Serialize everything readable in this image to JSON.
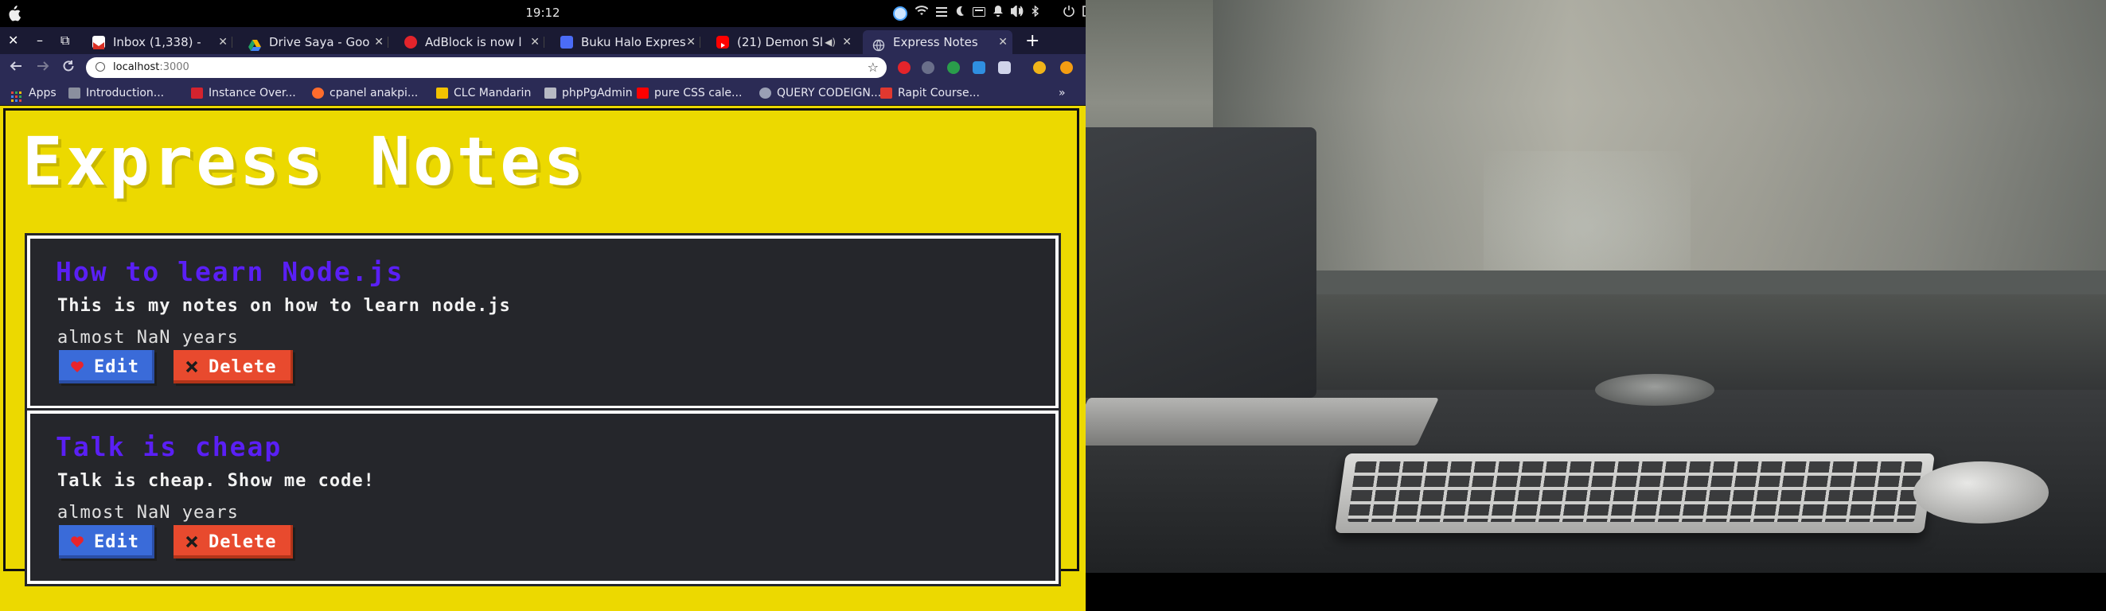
{
  "system_bar": {
    "clock": "19:12"
  },
  "browser": {
    "window_controls": [
      "✕",
      "–",
      "⧉"
    ],
    "tabs": [
      {
        "title": "Inbox (1,338) -",
        "favicon_color": "#d93025",
        "icon": "gmail-icon"
      },
      {
        "title": "Drive Saya - Goo",
        "favicon_color": "#1fa463",
        "icon": "drive-icon"
      },
      {
        "title": "AdBlock is now l",
        "favicon_color": "#e3242b",
        "icon": "adblock-icon"
      },
      {
        "title": "Buku Halo Expres",
        "favicon_color": "#4b6cf7",
        "icon": "doc-icon"
      },
      {
        "title": "(21) Demon Sl",
        "favicon_color": "#ff0000",
        "icon": "youtube-icon"
      },
      {
        "title": "Express Notes",
        "favicon_color": "#9aa0b5",
        "icon": "globe-icon"
      }
    ],
    "new_tab": "+",
    "url": {
      "host": "localhost",
      "port": ":3000"
    },
    "bookmarks": [
      {
        "label": "Apps",
        "color": "#e2483d"
      },
      {
        "label": "Introduction...",
        "color": "#8a8f9e"
      },
      {
        "label": "Instance Over...",
        "color": "#d4232e"
      },
      {
        "label": "cpanel anakpi...",
        "color": "#ff6c2c"
      },
      {
        "label": "CLC Mandarin",
        "color": "#f2c200"
      },
      {
        "label": "phpPgAdmin",
        "color": "#b7bac4"
      },
      {
        "label": "pure CSS cale...",
        "color": "#ff0000"
      },
      {
        "label": "QUERY CODEIGN...",
        "color": "#9aa0b5"
      },
      {
        "label": "Rapit Course...",
        "color": "#e0382f"
      }
    ],
    "bookmarks_overflow": "»"
  },
  "page": {
    "title": "Express Notes",
    "notes": [
      {
        "title": "How to learn Node.js",
        "body": "This is my notes on how to learn node.js",
        "time": "almost NaN years",
        "edit_label": "Edit",
        "delete_label": "Delete"
      },
      {
        "title": "Talk is cheap",
        "body": "Talk is cheap. Show me code!",
        "time": "almost NaN years",
        "edit_label": "Edit",
        "delete_label": "Delete"
      }
    ]
  },
  "colors": {
    "page_background": "#ecd900",
    "card_background": "#25262b",
    "note_title": "#5a1ff5",
    "edit_button": "#3a6bd9",
    "delete_button": "#e84a2e",
    "tab_strip": "#1a1a33"
  }
}
